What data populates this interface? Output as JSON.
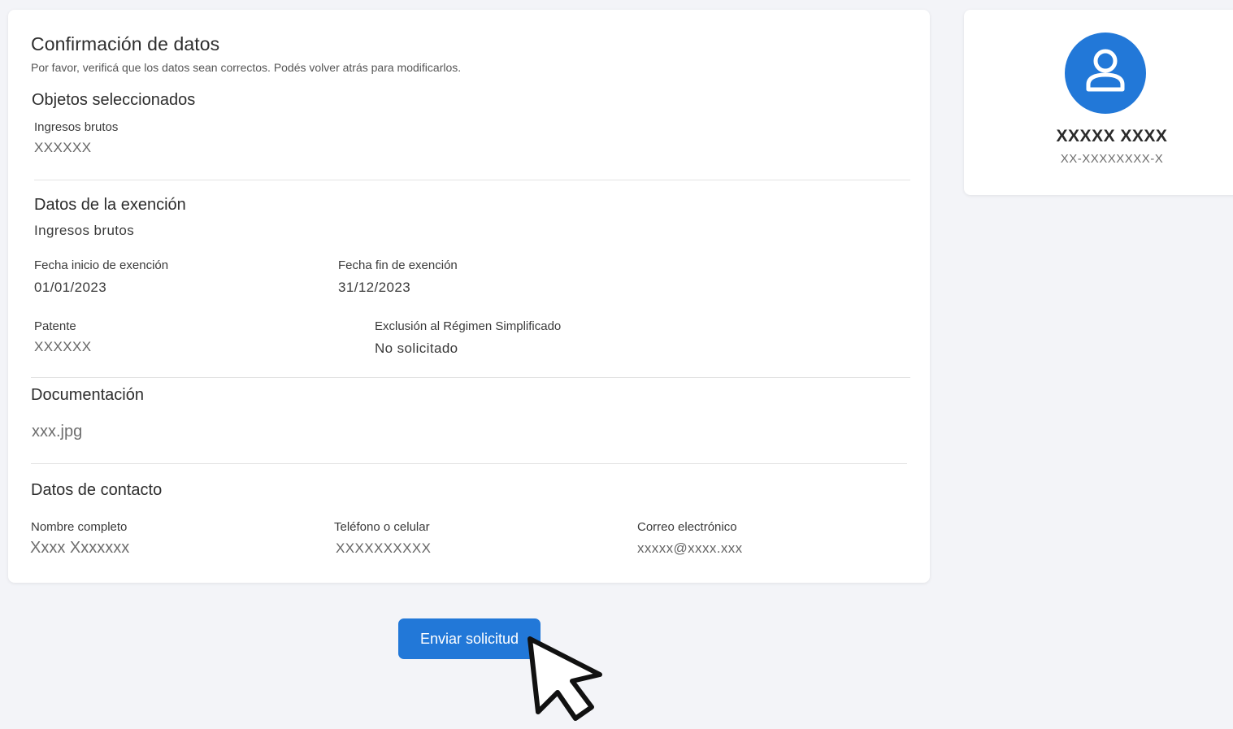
{
  "confirmation": {
    "title": "Confirmación de datos",
    "subtitle": "Por favor, verificá que los datos sean correctos. Podés volver atrás para modificarlos."
  },
  "objects": {
    "title": "Objetos seleccionados",
    "item_label": "Ingresos brutos",
    "item_value": "XXXXXX"
  },
  "exemption": {
    "title": "Datos de la exención",
    "subtitle": "Ingresos brutos",
    "start_label": "Fecha inicio de exención",
    "start_value": "01/01/2023",
    "end_label": "Fecha fin de exención",
    "end_value": "31/12/2023",
    "plate_label": "Patente",
    "plate_value": "XXXXXX",
    "exclusion_label": "Exclusión al Régimen Simplificado",
    "exclusion_value": "No solicitado"
  },
  "documentation": {
    "title": "Documentación",
    "file": "xxx.jpg"
  },
  "contact": {
    "title": "Datos de contacto",
    "name_label": "Nombre completo",
    "name_value": "Xxxx Xxxxxxx",
    "phone_label": "Teléfono o celular",
    "phone_value": "XXXXXXXXXX",
    "email_label": "Correo electrónico",
    "email_value": "xxxxx@xxxx.xxx"
  },
  "profile": {
    "name": "XXXXX XXXX",
    "id": "XX-XXXXXXXX-X",
    "icon": "user-icon"
  },
  "actions": {
    "submit_label": "Enviar solicitud"
  },
  "colors": {
    "accent": "#2278d8",
    "background": "#f3f4f8"
  }
}
